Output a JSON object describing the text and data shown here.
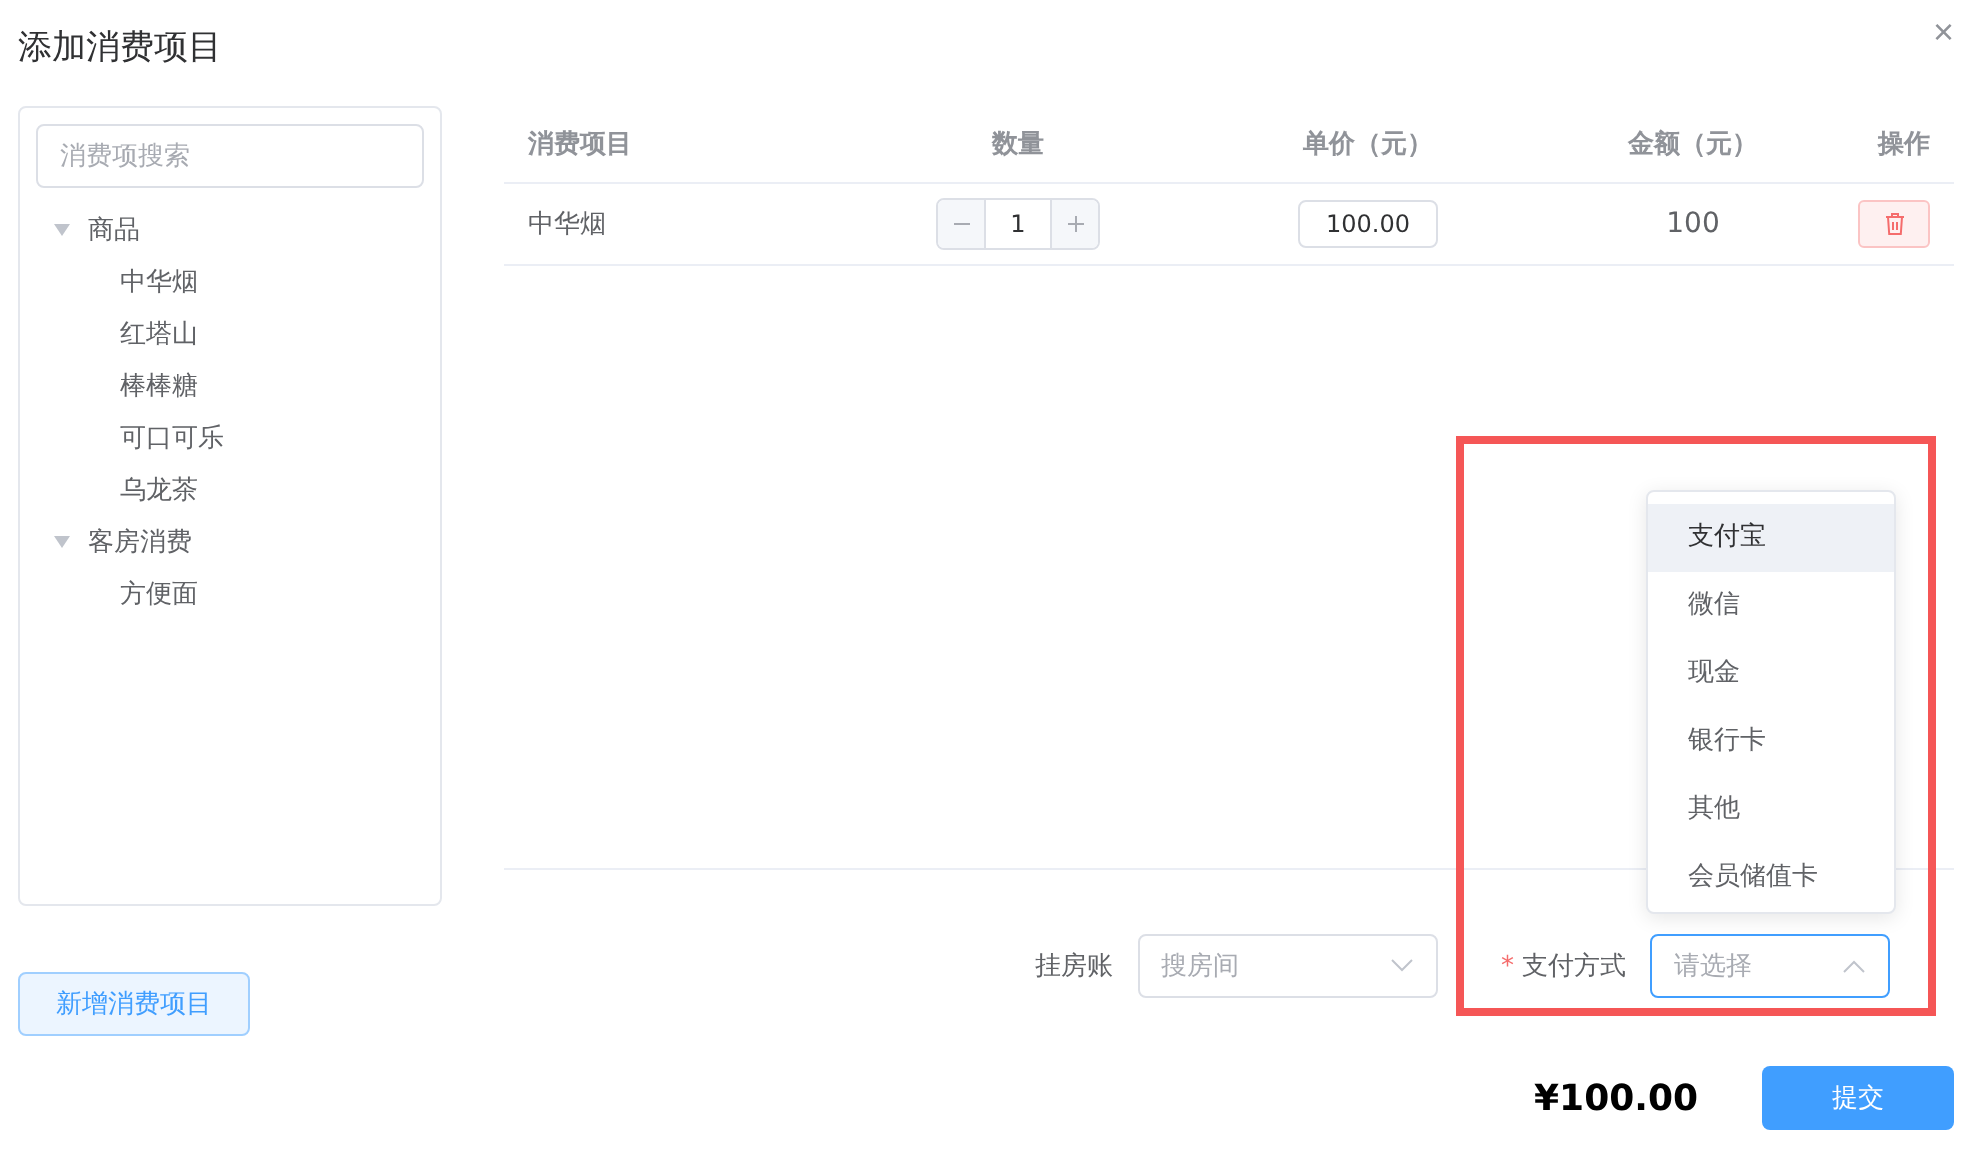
{
  "dialog": {
    "title": "添加消费项目",
    "close": "×"
  },
  "sidebar": {
    "search": {
      "placeholder": "消费项搜索"
    },
    "tree": [
      {
        "label": "商品",
        "expanded": true,
        "children": [
          {
            "label": "中华烟"
          },
          {
            "label": "红塔山"
          },
          {
            "label": "棒棒糖"
          },
          {
            "label": "可口可乐"
          },
          {
            "label": "乌龙茶"
          }
        ]
      },
      {
        "label": "客房消费",
        "expanded": true,
        "children": [
          {
            "label": "方便面"
          }
        ]
      }
    ],
    "add_button": "新增消费项目"
  },
  "table": {
    "columns": [
      "消费项目",
      "数量",
      "单价（元）",
      "金额（元）",
      "操作"
    ],
    "rows": [
      {
        "item": "中华烟",
        "quantity": "1",
        "unit_price": "100.00",
        "amount": "100"
      }
    ]
  },
  "form": {
    "room_account": {
      "label": "挂房账",
      "placeholder": "搜房间"
    },
    "payment": {
      "label": "支付方式",
      "required": true,
      "required_mark": "*",
      "placeholder": "请选择",
      "open": true,
      "options": [
        {
          "label": "支付宝",
          "highlighted": true
        },
        {
          "label": "微信",
          "highlighted": false
        },
        {
          "label": "现金",
          "highlighted": false
        },
        {
          "label": "银行卡",
          "highlighted": false
        },
        {
          "label": "其他",
          "highlighted": false
        },
        {
          "label": "会员储值卡",
          "highlighted": false
        }
      ]
    }
  },
  "total": "¥100.00",
  "submit_button": "提交"
}
